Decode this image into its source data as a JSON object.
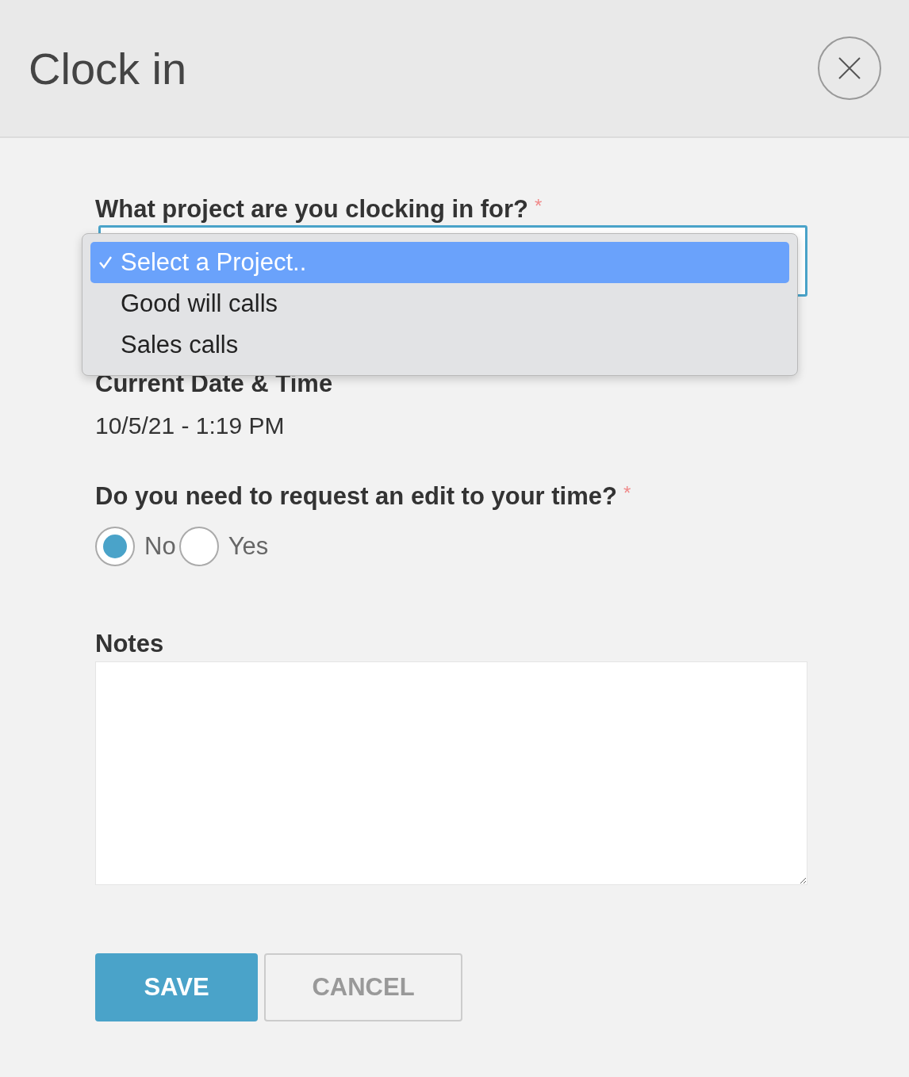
{
  "title": "Clock in",
  "project": {
    "label": "What project are you clocking in for?",
    "required_mark": "*",
    "options": [
      {
        "label": "Select a Project..",
        "selected": true
      },
      {
        "label": "Good will calls",
        "selected": false
      },
      {
        "label": "Sales calls",
        "selected": false
      }
    ]
  },
  "datetime": {
    "label": "Current Date & Time",
    "value": "10/5/21 - 1:19 PM"
  },
  "edit_request": {
    "label": "Do you need to request an edit to your time?",
    "required_mark": "*",
    "options": [
      {
        "label": "No",
        "selected": true
      },
      {
        "label": "Yes",
        "selected": false
      }
    ]
  },
  "notes": {
    "label": "Notes"
  },
  "buttons": [
    {
      "label": "SAVE",
      "kind": "primary"
    },
    {
      "label": "CANCEL",
      "kind": "secondary"
    }
  ]
}
